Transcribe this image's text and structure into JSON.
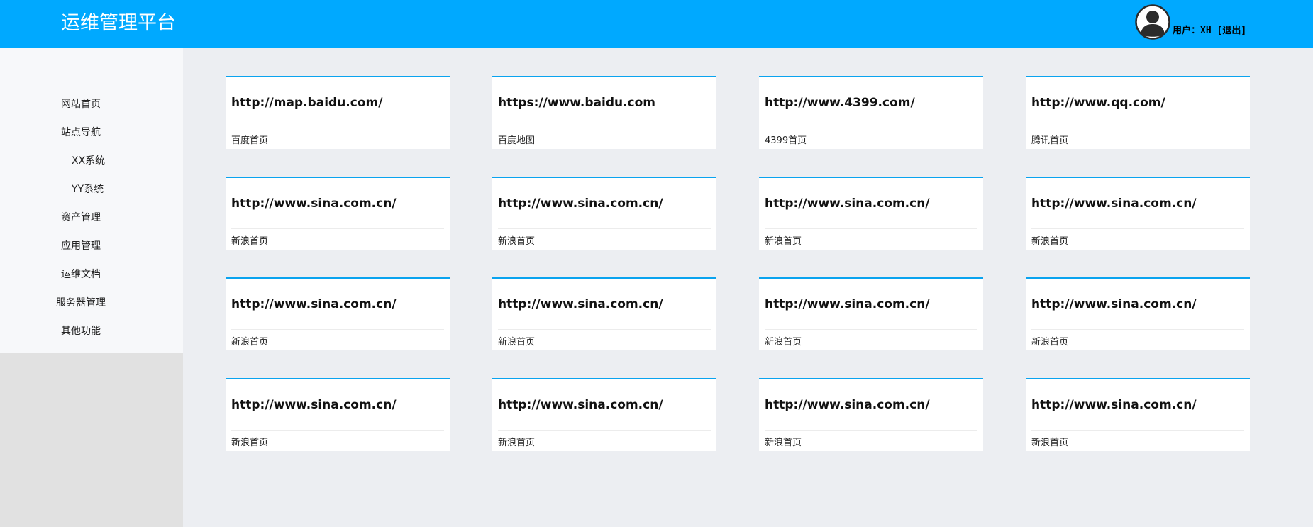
{
  "header": {
    "title": "运维管理平台",
    "user_label": "用户：",
    "username": "XH",
    "logout_label": "[退出]",
    "avatar_icon": "user-avatar-icon",
    "background_color": "#00a9ff"
  },
  "sidebar": {
    "items": [
      {
        "label": "网站首页",
        "level": "top"
      },
      {
        "label": "站点导航",
        "level": "top"
      },
      {
        "label": "XX系统",
        "level": "sub"
      },
      {
        "label": "YY系统",
        "level": "sub"
      },
      {
        "label": "资产管理",
        "level": "top"
      },
      {
        "label": "应用管理",
        "level": "top"
      },
      {
        "label": "运维文档",
        "level": "top"
      },
      {
        "label": "服务器管理",
        "level": "top"
      },
      {
        "label": "其他功能",
        "level": "top"
      }
    ]
  },
  "cards": [
    {
      "url": "http://map.baidu.com/",
      "name": "百度首页"
    },
    {
      "url": "https://www.baidu.com",
      "name": "百度地图"
    },
    {
      "url": "http://www.4399.com/",
      "name": "4399首页"
    },
    {
      "url": "http://www.qq.com/",
      "name": "腾讯首页"
    },
    {
      "url": "http://www.sina.com.cn/",
      "name": "新浪首页"
    },
    {
      "url": "http://www.sina.com.cn/",
      "name": "新浪首页"
    },
    {
      "url": "http://www.sina.com.cn/",
      "name": "新浪首页"
    },
    {
      "url": "http://www.sina.com.cn/",
      "name": "新浪首页"
    },
    {
      "url": "http://www.sina.com.cn/",
      "name": "新浪首页"
    },
    {
      "url": "http://www.sina.com.cn/",
      "name": "新浪首页"
    },
    {
      "url": "http://www.sina.com.cn/",
      "name": "新浪首页"
    },
    {
      "url": "http://www.sina.com.cn/",
      "name": "新浪首页"
    },
    {
      "url": "http://www.sina.com.cn/",
      "name": "新浪首页"
    },
    {
      "url": "http://www.sina.com.cn/",
      "name": "新浪首页"
    },
    {
      "url": "http://www.sina.com.cn/",
      "name": "新浪首页"
    },
    {
      "url": "http://www.sina.com.cn/",
      "name": "新浪首页"
    }
  ],
  "colors": {
    "accent": "#0aa3ef",
    "main_background": "#eceef2",
    "sidebar_background": "#f7f8fa"
  }
}
